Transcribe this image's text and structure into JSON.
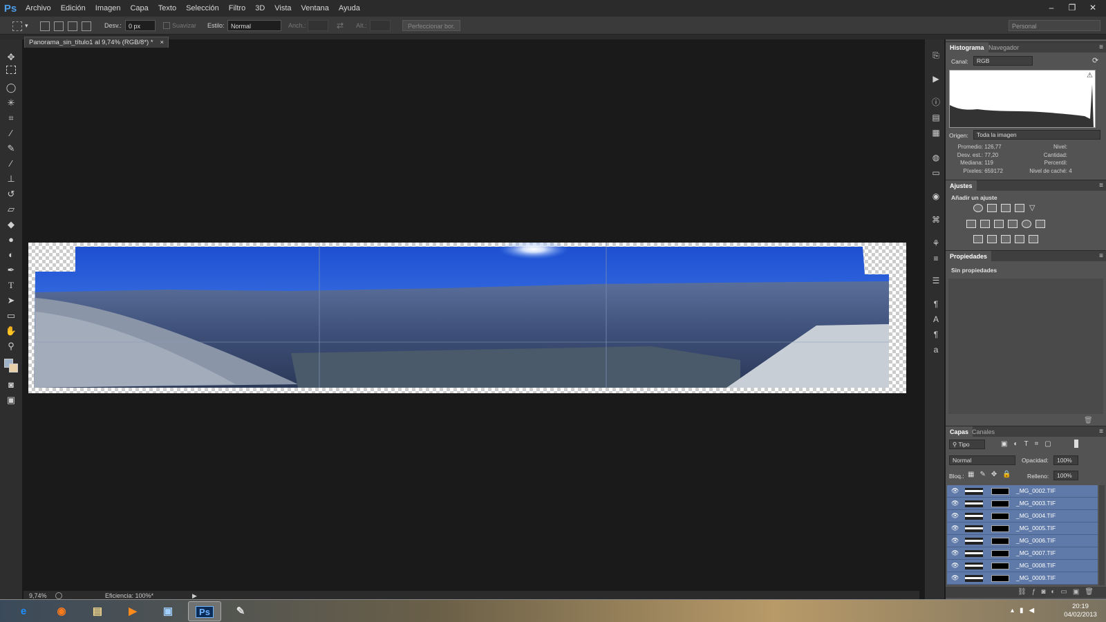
{
  "app": {
    "logo": "Ps"
  },
  "menu": [
    "Archivo",
    "Edición",
    "Imagen",
    "Capa",
    "Texto",
    "Selección",
    "Filtro",
    "3D",
    "Vista",
    "Ventana",
    "Ayuda"
  ],
  "window_controls": [
    "–",
    "❐",
    "✕"
  ],
  "options": {
    "feather_label": "Desv.:",
    "feather_value": "0 px",
    "antialias_label": "Suavizar",
    "style_label": "Estilo:",
    "style_value": "Normal",
    "width_label": "Anch.:",
    "height_label": "Alt.:",
    "refine_button": "Perfeccionar bor.",
    "workspace": "Personal"
  },
  "document": {
    "tab_title": "Panorama_sin_título1 al 9,74% (RGB/8*) *",
    "close": "×"
  },
  "status": {
    "zoom": "9,74%",
    "efficiency": "Eficiencia: 100%*"
  },
  "histogram": {
    "tab_active": "Histograma",
    "tab_inactive": "Navegador",
    "channel_label": "Canal:",
    "channel_value": "RGB",
    "source_label": "Origen:",
    "source_value": "Toda la imagen",
    "stats_left": [
      {
        "label": "Promedio:",
        "value": "126,77"
      },
      {
        "label": "Desv. est.:",
        "value": "77,20"
      },
      {
        "label": "Mediana:",
        "value": "119"
      },
      {
        "label": "Píxeles:",
        "value": "659172"
      }
    ],
    "stats_right": [
      {
        "label": "Nivel:",
        "value": ""
      },
      {
        "label": "Cantidad:",
        "value": ""
      },
      {
        "label": "Percentil:",
        "value": ""
      },
      {
        "label": "Nivel de caché:",
        "value": "4"
      }
    ]
  },
  "adjustments": {
    "tab": "Ajustes",
    "heading": "Añadir un ajuste"
  },
  "properties": {
    "tab": "Propiedades",
    "empty": "Sin propiedades"
  },
  "layers": {
    "tab_active": "Capas",
    "tab_inactive": "Canales",
    "filter_value": "Tipo",
    "blend_value": "Normal",
    "opacity_label": "Opacidad:",
    "opacity_value": "100%",
    "lock_label": "Bloq.:",
    "fill_label": "Relleno:",
    "fill_value": "100%",
    "items": [
      "_MG_0002.TIF",
      "_MG_0003.TIF",
      "_MG_0004.TIF",
      "_MG_0005.TIF",
      "_MG_0006.TIF",
      "_MG_0007.TIF",
      "_MG_0008.TIF",
      "_MG_0009.TIF"
    ]
  },
  "taskbar": {
    "time": "20:19",
    "date": "04/02/2013",
    "ps_label": "Ps"
  }
}
